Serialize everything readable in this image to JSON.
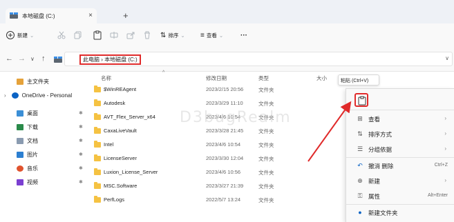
{
  "window": {
    "tab_label": "本地磁盘 (C:)",
    "close_glyph": "×",
    "new_tab_glyph": "+"
  },
  "toolbar": {
    "new_label": "新建",
    "sort_label": "排序",
    "view_label": "查看",
    "more_glyph": "···"
  },
  "address": {
    "back": "←",
    "forward": "→",
    "recent": "∨",
    "up": "↑",
    "breadcrumb": "此电脑 › 本地磁盘 (C:)",
    "expand_glyph": "∨"
  },
  "sidebar": {
    "items": [
      {
        "label": "主文件夹",
        "icon": "home-icon",
        "color": "#e5a23a"
      },
      {
        "label": "OneDrive - Personal",
        "icon": "cloud-icon",
        "color": "#0b63c4"
      },
      {
        "label": "桌面",
        "icon": "desktop-icon",
        "color": "#3b8fd6"
      },
      {
        "label": "下载",
        "icon": "download-icon",
        "color": "#2a8a4a"
      },
      {
        "label": "文档",
        "icon": "document-icon",
        "color": "#8a9bb0"
      },
      {
        "label": "图片",
        "icon": "pictures-icon",
        "color": "#2c7fd1"
      },
      {
        "label": "音乐",
        "icon": "music-icon",
        "color": "#e0532e"
      },
      {
        "label": "视频",
        "icon": "video-icon",
        "color": "#7b3fd1"
      }
    ],
    "pin_glyph": "✱"
  },
  "columns": {
    "name": "名称",
    "date": "修改日期",
    "type": "类型",
    "size": "大小"
  },
  "files": [
    {
      "name": "$WinREAgent",
      "date": "2023/2/15 20:56",
      "type": "文件夹"
    },
    {
      "name": "Autodesk",
      "date": "2023/3/29 11:10",
      "type": "文件夹"
    },
    {
      "name": "AVT_Flex_Server_x64",
      "date": "2023/4/6 10:54",
      "type": "文件夹"
    },
    {
      "name": "CaxaLiveVault",
      "date": "2023/3/28 21:45",
      "type": "文件夹"
    },
    {
      "name": "Intel",
      "date": "2023/4/6 10:54",
      "type": "文件夹"
    },
    {
      "name": "LicenseServer",
      "date": "2023/3/30 12:04",
      "type": "文件夹"
    },
    {
      "name": "Luxion_License_Server",
      "date": "2023/4/6 10:56",
      "type": "文件夹"
    },
    {
      "name": "MSC.Software",
      "date": "2023/3/27 21:39",
      "type": "文件夹"
    },
    {
      "name": "PerfLogs",
      "date": "2022/5/7 13:24",
      "type": "文件夹"
    }
  ],
  "watermark": "D3bugRealm",
  "tooltip": "粘贴 (Ctrl+V)",
  "context_menu": {
    "items": [
      {
        "label": "查看",
        "icon": "grid-icon",
        "glyph": "⊞",
        "shortcut": "",
        "submenu": true
      },
      {
        "label": "排序方式",
        "icon": "sort-icon",
        "glyph": "⇅",
        "shortcut": "",
        "submenu": true
      },
      {
        "label": "分组依据",
        "icon": "group-icon",
        "glyph": "☰",
        "shortcut": "",
        "submenu": true
      },
      {
        "label": "撤消 删除",
        "icon": "undo-icon",
        "glyph": "↶",
        "shortcut": "Ctrl+Z",
        "submenu": false
      },
      {
        "label": "新建",
        "icon": "plus-circle-icon",
        "glyph": "⊕",
        "shortcut": "",
        "submenu": true
      },
      {
        "label": "属性",
        "icon": "key-icon",
        "glyph": "⚿",
        "shortcut": "Alt+Enter",
        "submenu": false
      },
      {
        "label": "新建文件夹",
        "icon": "new-folder-icon",
        "glyph": "●",
        "shortcut": "",
        "submenu": false
      }
    ],
    "submenu_glyph": "›"
  },
  "colors": {
    "highlight": "#e02a2a",
    "folder": "#f5c242",
    "accent": "#0b63c4"
  }
}
